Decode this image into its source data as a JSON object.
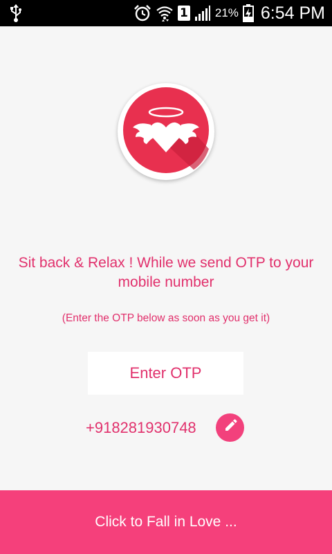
{
  "status_bar": {
    "battery_percent": "21%",
    "time": "6:54 PM",
    "sim_slot": "1",
    "icons": [
      "usb-icon",
      "alarm-icon",
      "wifi-icon",
      "sim-icon",
      "signal-icon",
      "battery-icon"
    ]
  },
  "logo": {
    "icon": "angel-heart-icon",
    "colors": {
      "circle": "#e8304f",
      "heart": "#ffffff"
    }
  },
  "content": {
    "headline": "Sit back & Relax ! While we send OTP to your mobile number",
    "subline": "(Enter the OTP below as soon as you get it)"
  },
  "otp": {
    "placeholder": "Enter OTP",
    "value": ""
  },
  "phone": {
    "number": "+918281930748",
    "edit_icon": "pencil-icon"
  },
  "cta": {
    "label": "Click to Fall in Love ..."
  },
  "theme": {
    "accent": "#e1306c",
    "button": "#f5407b",
    "background": "#f6f6f6"
  }
}
